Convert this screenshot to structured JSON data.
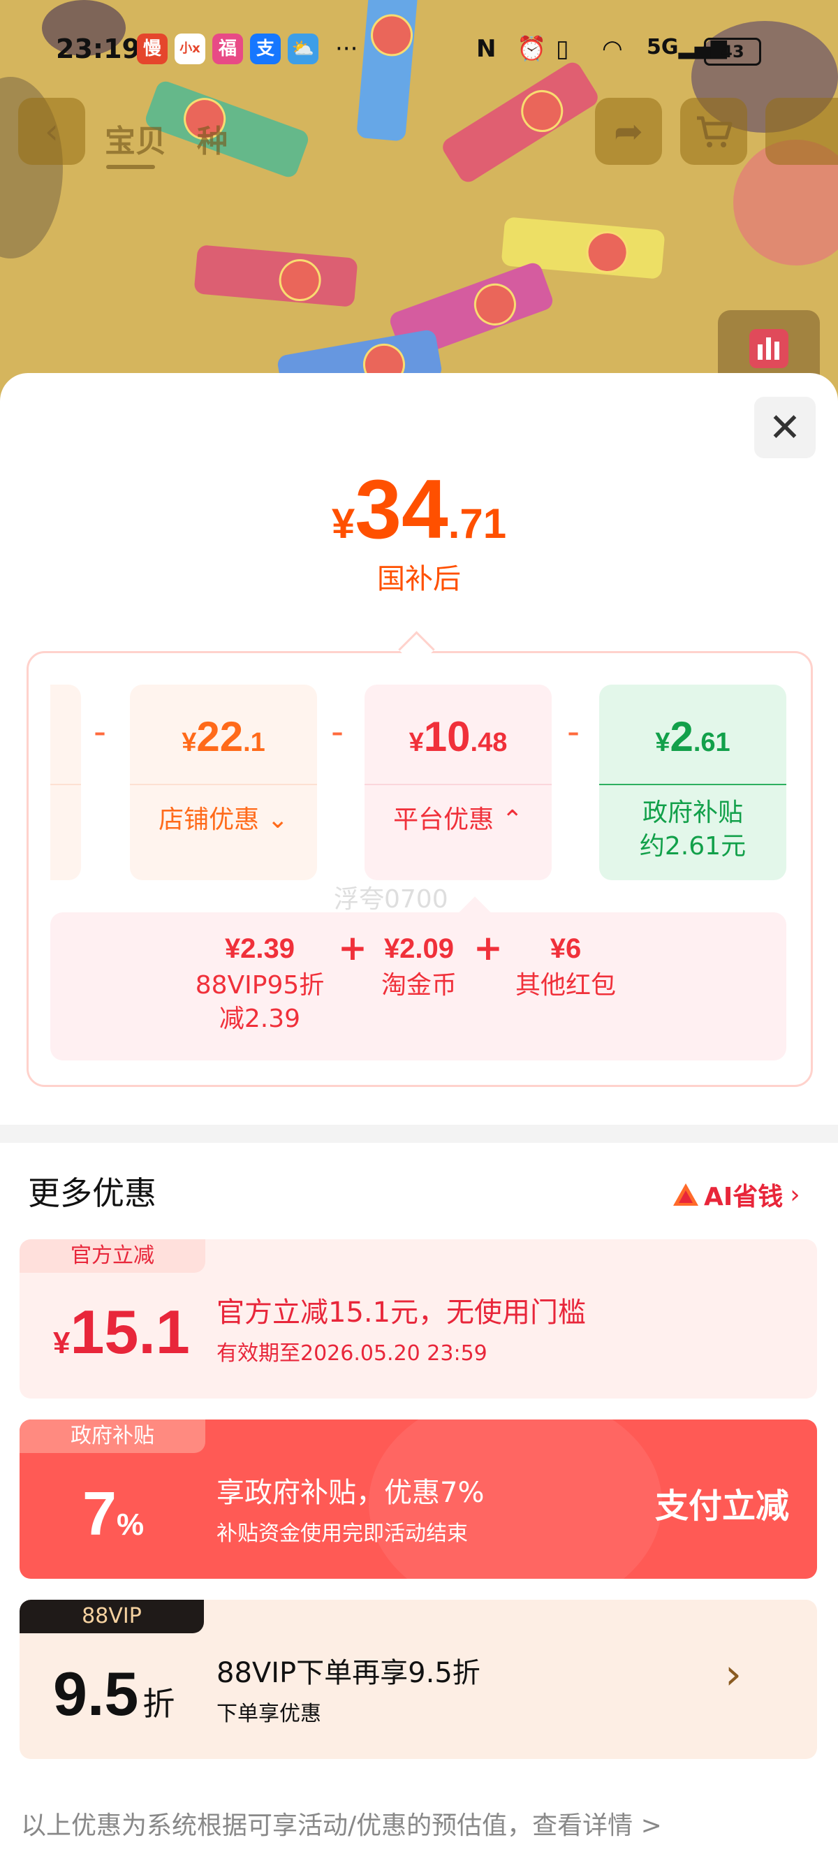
{
  "status_bar": {
    "time": "23:19",
    "app_icons": [
      "慢",
      "小x",
      "福",
      "支",
      "⛅"
    ],
    "more": "···",
    "battery": "43"
  },
  "nav": {
    "tab_product": "宝贝",
    "tab_reviews": "种"
  },
  "price": {
    "symbol": "¥",
    "integer": "34",
    "decimal": ".71",
    "caption": "国补后"
  },
  "breakdown": {
    "shop": {
      "symbol": "¥",
      "integer": "22",
      "decimal": ".1",
      "label": "店铺优惠"
    },
    "platform": {
      "symbol": "¥",
      "integer": "10",
      "decimal": ".48",
      "label": "平台优惠"
    },
    "gov": {
      "symbol": "¥",
      "integer": "2",
      "decimal": ".61",
      "label_1": "政府补贴",
      "label_2": "约2.61元"
    },
    "platform_detail": [
      {
        "value": "¥2.39",
        "name_1": "88VIP95折",
        "name_2": "减2.39"
      },
      {
        "value": "¥2.09",
        "name_1": "淘金币",
        "name_2": ""
      },
      {
        "value": "¥6",
        "name_1": "其他红包",
        "name_2": ""
      }
    ],
    "watermark": "浮夸0700"
  },
  "more": {
    "title": "更多优惠",
    "ai_link": "AI省钱",
    "cards": [
      {
        "tag": "官方立减",
        "symbol": "¥",
        "amount": "15.1",
        "line1": "官方立减15.1元，无使用门槛",
        "line2": "有效期至2026.05.20 23:59"
      },
      {
        "tag": "政府补贴",
        "amount": "7",
        "unit": "%",
        "line1": "享政府补贴，优惠7%",
        "line2": "补贴资金使用完即活动结束",
        "action": "支付立减"
      },
      {
        "tag": "88VIP",
        "amount": "9.5",
        "unit": "折",
        "line1": "88VIP下单再享9.5折",
        "line2": "下单享优惠"
      }
    ],
    "footer": "以上优惠为系统根据可享活动/优惠的预估值，查看详情 >"
  },
  "colors": {
    "accent": "#ff5000",
    "red": "#f0303a",
    "green": "#12a04a",
    "gov_card": "#ff5a55"
  }
}
